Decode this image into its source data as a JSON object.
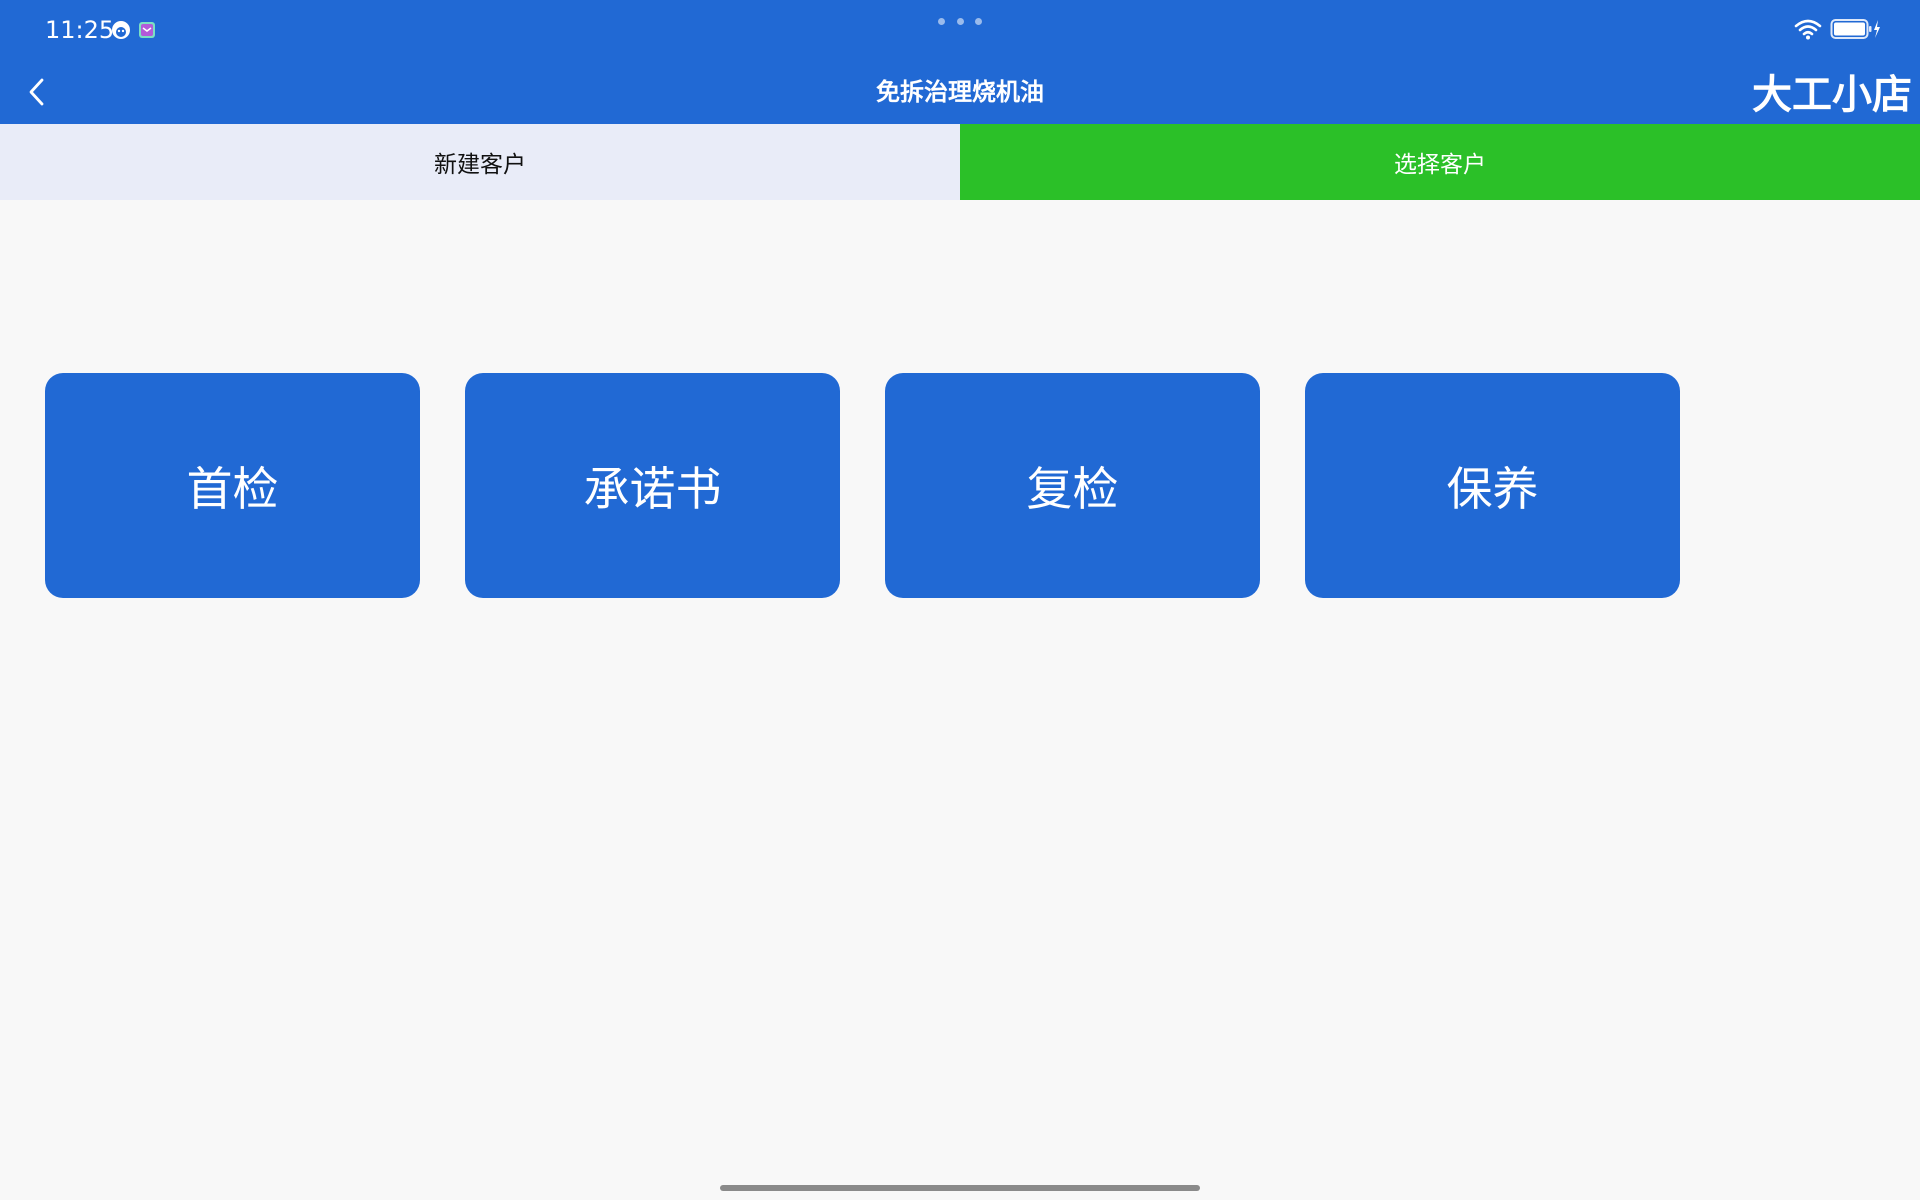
{
  "status_bar": {
    "time": "11:25"
  },
  "nav": {
    "title": "免拆治理烧机油",
    "shop_name": "大工小店"
  },
  "tabs": [
    {
      "label": "新建客户",
      "active": false
    },
    {
      "label": "选择客户",
      "active": true
    }
  ],
  "actions": [
    {
      "label": "首检"
    },
    {
      "label": "承诺书"
    },
    {
      "label": "复检"
    },
    {
      "label": "保养"
    }
  ],
  "colors": {
    "primary": "#2169d4",
    "tab_active": "#2bc028",
    "tab_inactive": "#e9ecf8",
    "background": "#f8f8f8"
  },
  "icons": {
    "back": "chevron-left-icon",
    "wifi": "wifi-icon",
    "battery": "battery-charging-icon"
  }
}
